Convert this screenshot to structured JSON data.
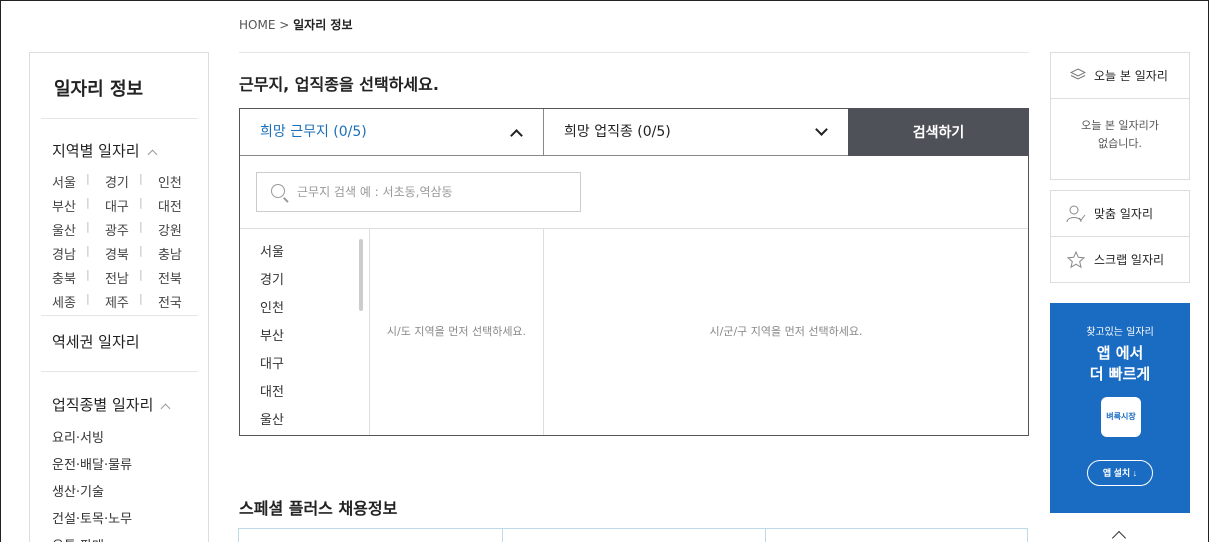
{
  "breadcrumb": {
    "home": "HOME",
    "sep": ">",
    "current": "일자리 정보"
  },
  "sidebar": {
    "title": "일자리 정보",
    "region_heading": "지역별 일자리",
    "regions": [
      [
        "서울",
        "경기",
        "인천"
      ],
      [
        "부산",
        "대구",
        "대전"
      ],
      [
        "울산",
        "광주",
        "강원"
      ],
      [
        "경남",
        "경북",
        "충남"
      ],
      [
        "충북",
        "전남",
        "전북"
      ],
      [
        "세종",
        "제주",
        "전국"
      ]
    ],
    "region_sep": "|",
    "station_heading": "역세권 일자리",
    "job_heading": "업직종별 일자리",
    "jobs": [
      "요리·서빙",
      "운전·배달·물류",
      "생산·기술",
      "건설·토목·노무",
      "유통·판매"
    ]
  },
  "main": {
    "title": "근무지, 업직종을 선택하세요.",
    "location_tab": "희망 근무지 (0/5)",
    "job_tab": "희망 업직종 (0/5)",
    "search_button": "검색하기",
    "search_placeholder": "근무지 검색 예 : 서초동,역삼동",
    "provinces": [
      "서울",
      "경기",
      "인천",
      "부산",
      "대구",
      "대전",
      "울산"
    ],
    "col2_hint": "시/도 지역을 먼저 선택하세요.",
    "col3_hint": "시/군/구 지역을 먼저 선택하세요.",
    "special_title": "스페셜 플러스 채용정보"
  },
  "right": {
    "today_heading": "오늘 본 일자리",
    "today_empty_1": "오늘 본 일자리가",
    "today_empty_2": "없습니다.",
    "match": "맞춤 일자리",
    "scrap": "스크랩 일자리",
    "banner_small": "찾고있는 일자리",
    "banner_big_1": "앱 에서",
    "banner_big_2": "더 빠르게",
    "banner_logo": "벼룩시장",
    "banner_install": "앱 설치 ↓"
  },
  "colors": {
    "accent_blue": "#1b6fb8",
    "search_button_bg": "#4e5157",
    "banner_bg": "#1a6bc2"
  }
}
